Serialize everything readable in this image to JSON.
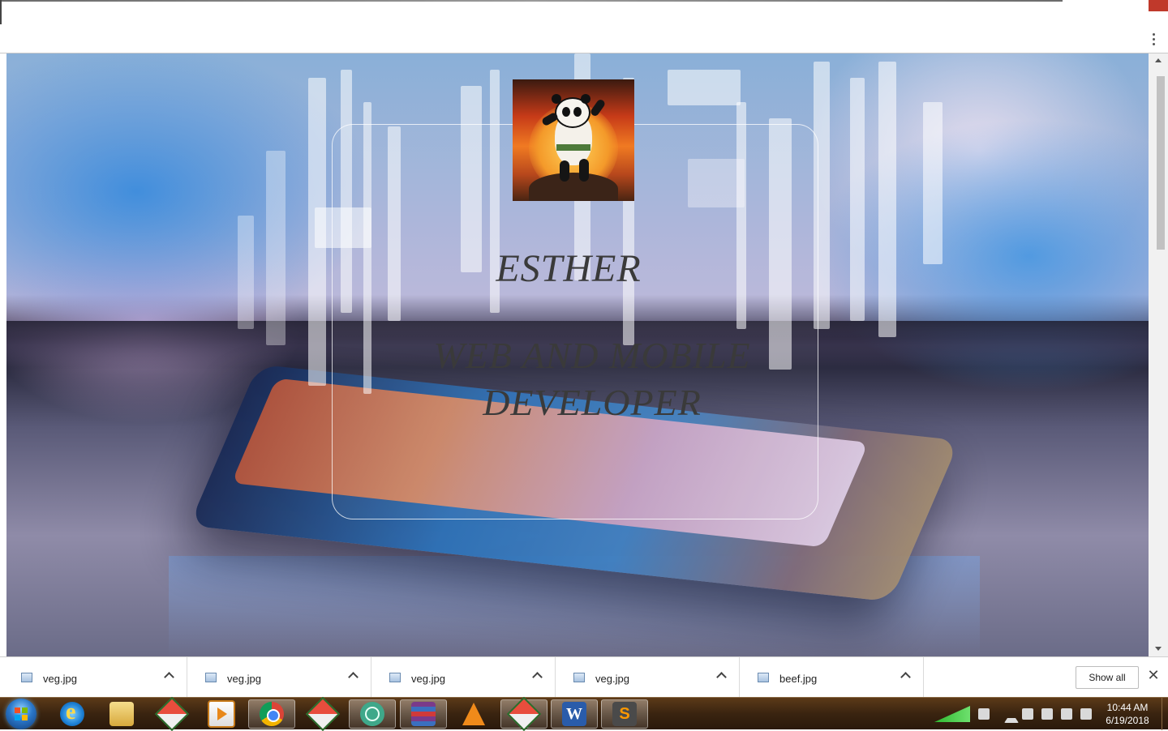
{
  "hero": {
    "name": "ESTHER",
    "title": "WEB AND MOBILE DEVELOPER",
    "avatar_icon": "kung-fu-panda-avatar"
  },
  "downloads": {
    "items": [
      {
        "name": "veg.jpg",
        "icon": "image-file-icon"
      },
      {
        "name": "veg.jpg",
        "icon": "image-file-icon"
      },
      {
        "name": "veg.jpg",
        "icon": "image-file-icon"
      },
      {
        "name": "veg.jpg",
        "icon": "image-file-icon"
      },
      {
        "name": "beef.jpg",
        "icon": "image-file-icon"
      }
    ],
    "show_all_label": "Show all",
    "close_icon": "close-icon"
  },
  "taskbar": {
    "apps": [
      "internet-explorer-icon",
      "file-explorer-icon",
      "git-icon",
      "media-player-icon",
      "chrome-icon",
      "git-gui-icon",
      "atom-icon",
      "winrar-icon",
      "vlc-icon",
      "git-bash-icon",
      "word-icon",
      "sublime-text-icon"
    ],
    "active_app": "chrome-icon",
    "word_letter": "W",
    "sublime_letter": "S",
    "clock": {
      "time": "10:44 AM",
      "date": "6/19/2018"
    }
  },
  "colors": {
    "taskbar": "#3a2410",
    "hero_text": "#3a3a3a",
    "shelf_bg": "#ffffff"
  }
}
